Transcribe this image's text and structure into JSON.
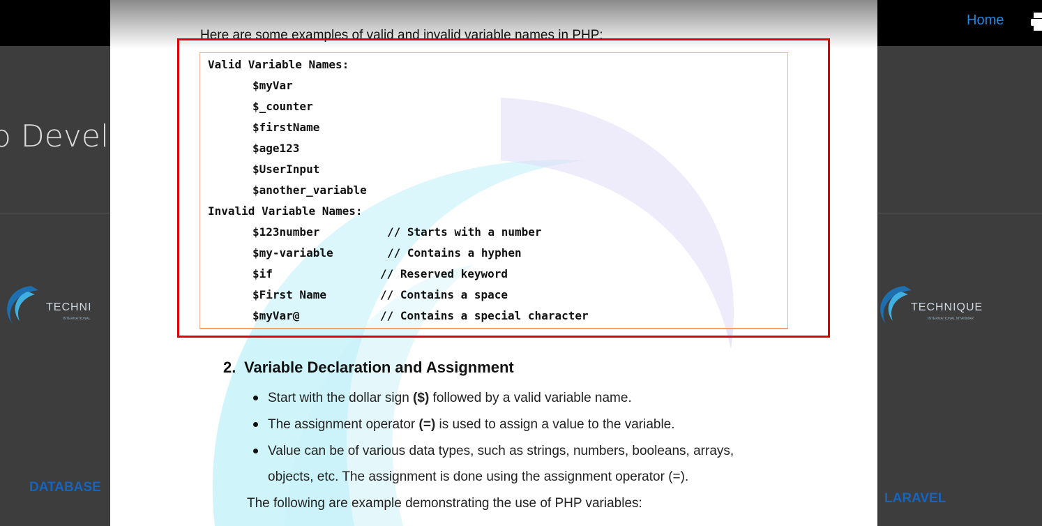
{
  "background": {
    "nav_home": "Home",
    "page_title": "b Develo",
    "logo_text": "TECHNIQUE",
    "logo_text_left": "TECHNI",
    "logo_sub": "INTERNATIONAL MYANMAR",
    "logo_sub_left": "INTERNATIONAL",
    "category_left": "DATABASE",
    "category_right": "LARAVEL"
  },
  "document": {
    "intro": "Here are some examples of valid and invalid variable names in PHP:",
    "valid_heading": "Valid Variable Names:",
    "valid_names": [
      "$myVar",
      "$_counter",
      "$firstName",
      "$age123",
      "$UserInput",
      "$another_variable"
    ],
    "invalid_heading": "Invalid Variable Names:",
    "invalid_names": [
      {
        "name": "$123number",
        "comment": "// Starts with a number"
      },
      {
        "name": "$my-variable",
        "comment": "// Contains a hyphen"
      },
      {
        "name": "$if",
        "comment": "// Reserved keyword"
      },
      {
        "name": "$First Name",
        "comment": "// Contains a space"
      },
      {
        "name": "$myVar@",
        "comment": "// Contains a special character"
      }
    ],
    "section_number": "2.",
    "section_title": "Variable Declaration and Assignment",
    "bullets": [
      {
        "pre": "Start with the dollar sign ",
        "bold": "($)",
        "post": " followed by a valid variable name."
      },
      {
        "pre": "The assignment operator ",
        "bold": "(=)",
        "post": " is used to assign a value to the variable."
      },
      {
        "pre": "Value can be of various data types, such as strings, numbers, booleans, arrays,",
        "bold": "",
        "post": ""
      }
    ],
    "bullet3_cont": "objects, etc. The assignment is done using the assignment operator (=).",
    "conclusion": "The following are example demonstrating the use of PHP variables:"
  },
  "colors": {
    "highlight": "#e10000",
    "code_border": "#f2b48c",
    "link_blue": "#1e88e5"
  }
}
